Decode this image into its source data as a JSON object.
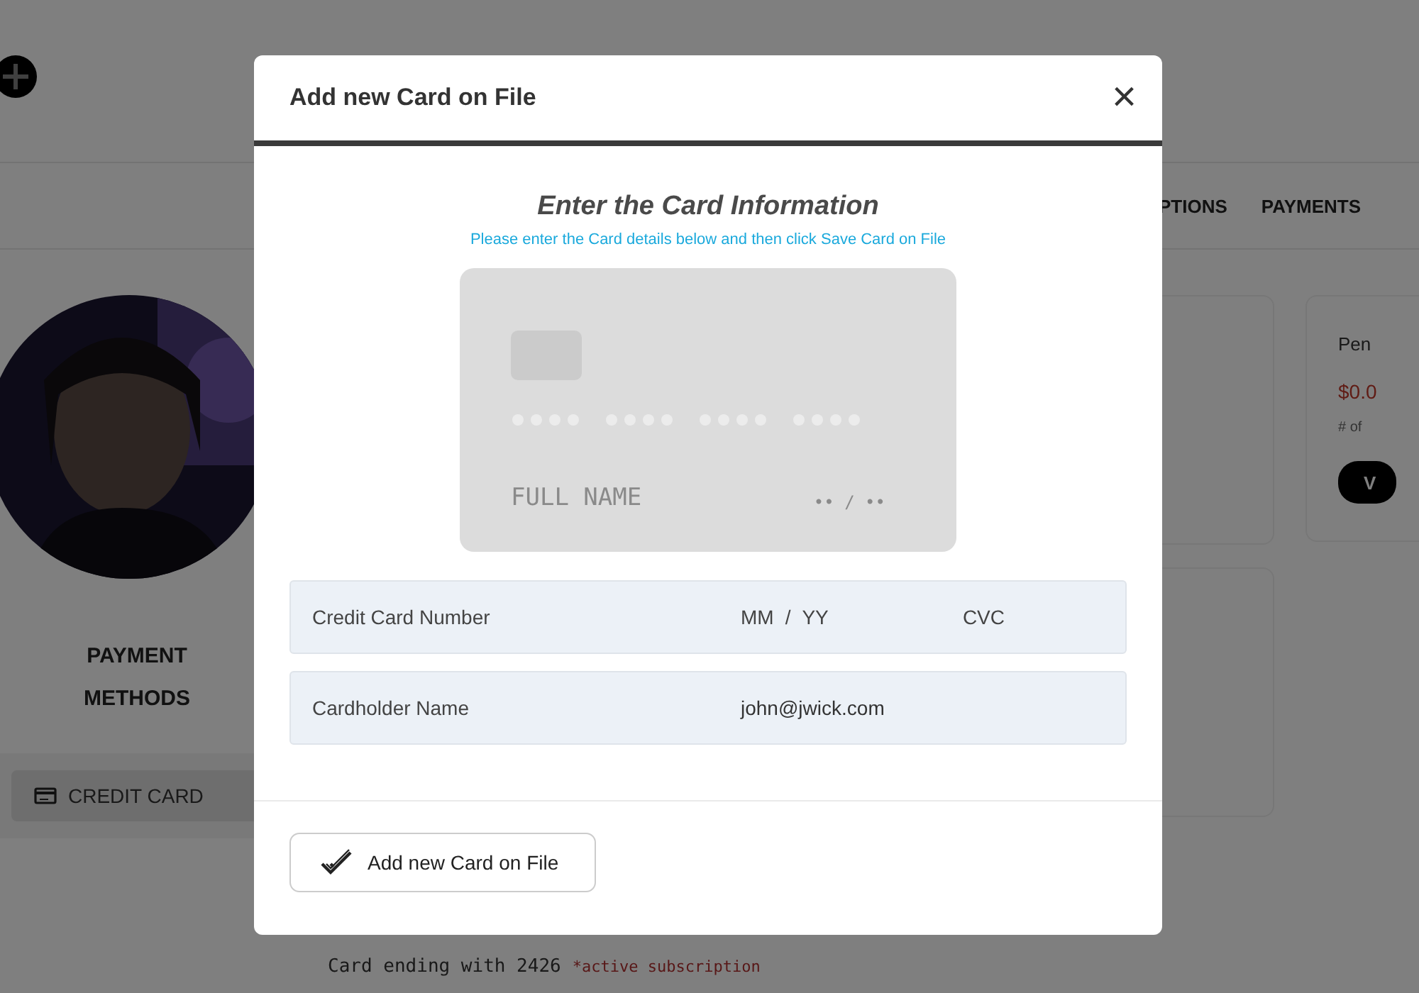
{
  "background": {
    "nav": [
      "PTIONS",
      "PAYMENTS"
    ],
    "sidebar": {
      "title": "PAYMENT METHODS",
      "items": [
        {
          "label": "CREDIT CARD",
          "selected": true
        }
      ]
    },
    "summary_card": {
      "title": "Pen",
      "amount": "$0.0",
      "caption": "# of",
      "button": "V"
    },
    "card_line": {
      "text": "Card ending with 2426",
      "note": "*active subscription"
    }
  },
  "modal": {
    "title": "Add new Card on File",
    "close": "×",
    "heading": "Enter the Card Information",
    "subtitle": "Please enter the Card details below and then click Save Card on File",
    "card_preview": {
      "name": "FULL NAME",
      "expiry": "•• / ••"
    },
    "rows": [
      {
        "fields": [
          {
            "kind": "placeholder",
            "text": "Credit Card Number"
          },
          {
            "kind": "placeholder",
            "text": "MM"
          },
          {
            "kind": "separator",
            "text": "/"
          },
          {
            "kind": "placeholder",
            "text": "YY"
          },
          {
            "kind": "placeholder",
            "text": "CVC"
          }
        ]
      },
      {
        "fields": [
          {
            "kind": "placeholder",
            "text": "Cardholder Name"
          },
          {
            "kind": "value",
            "text": "john@jwick.com"
          }
        ]
      }
    ],
    "submit": "Add new Card on File"
  }
}
